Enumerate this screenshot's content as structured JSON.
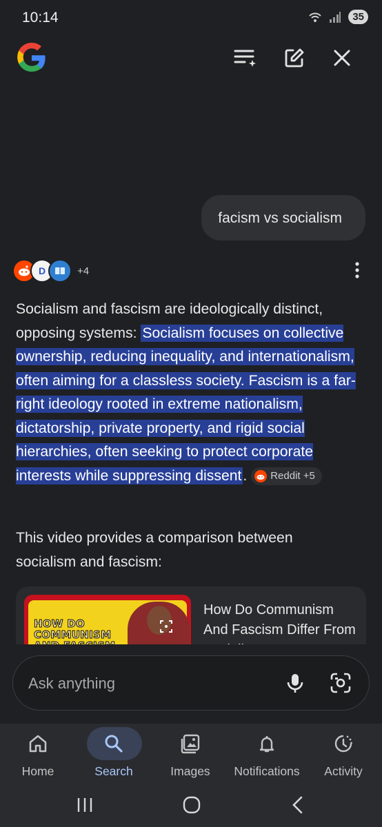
{
  "status": {
    "time": "10:14",
    "battery": "35"
  },
  "header": {
    "logo": "google-g-logo",
    "icons": [
      "ai-mode-list-icon",
      "new-chat-icon",
      "close-icon"
    ]
  },
  "query": "facism vs socialism",
  "sources": {
    "more": "+4"
  },
  "answer": {
    "lead": "Socialism and fascism are ideologically distinct, opposing systems: ",
    "highlight": "Socialism focuses on collective ownership, reducing inequality, and internationalism, often aiming for a classless society. Fascism is a far-right ideology rooted in extreme nationalism, dictatorship, private property, and rigid social hierarchies, often seeking to protect corporate interests while suppressing dissent",
    "period": ".",
    "chip": "Reddit +5"
  },
  "video_intro": "This video provides a comparison between socialism and fascism:",
  "video_card": {
    "thumb_text": "HOW DO\nCOMMUNISM\nAND FASCISM",
    "title": "How Do Communism And Fascism Differ From Socialism?"
  },
  "ask": {
    "placeholder": "Ask anything"
  },
  "nav": {
    "items": [
      {
        "label": "Home",
        "icon": "home-icon"
      },
      {
        "label": "Search",
        "icon": "search-icon",
        "active": true
      },
      {
        "label": "Images",
        "icon": "images-icon"
      },
      {
        "label": "Notifications",
        "icon": "bell-icon"
      },
      {
        "label": "Activity",
        "icon": "activity-icon"
      }
    ]
  },
  "colors": {
    "background": "#1f2023",
    "highlight": "#283f96",
    "active_nav": "#a8c7fa"
  }
}
